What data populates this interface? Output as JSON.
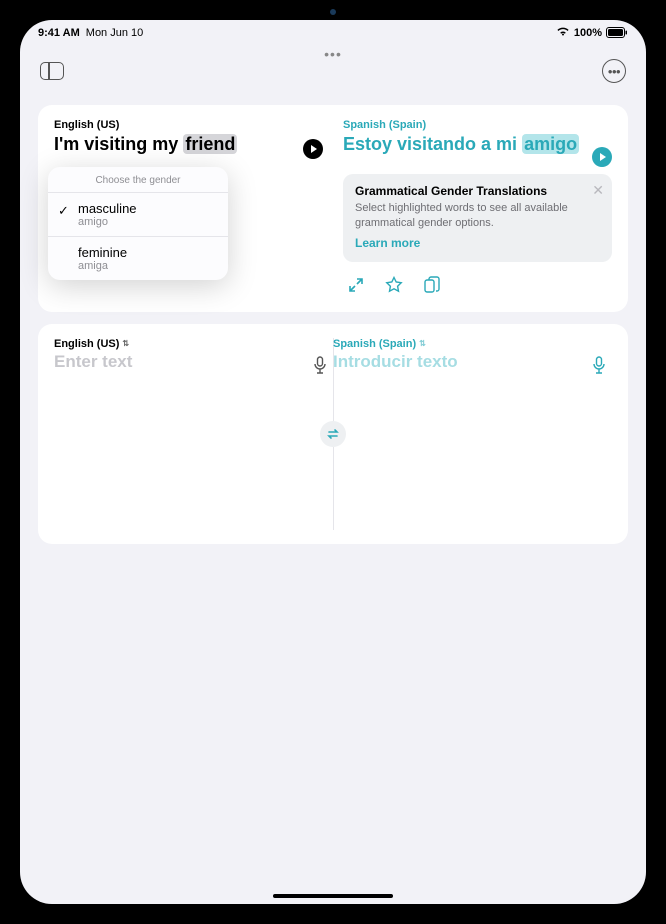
{
  "status": {
    "time": "9:41 AM",
    "date": "Mon Jun 10",
    "battery": "100%"
  },
  "source": {
    "lang": "English (US)",
    "prefix": "I'm visiting my ",
    "highlighted": "friend"
  },
  "target": {
    "lang": "Spanish (Spain)",
    "prefix": "Estoy visitando a mi ",
    "highlighted": "amigo"
  },
  "popover": {
    "header": "Choose the gender",
    "options": [
      {
        "title": "masculine",
        "subtitle": "amigo",
        "selected": true
      },
      {
        "title": "feminine",
        "subtitle": "amiga",
        "selected": false
      }
    ]
  },
  "info": {
    "title": "Grammatical Gender Translations",
    "desc": "Select highlighted words to see all available grammatical gender options.",
    "link": "Learn more"
  },
  "input": {
    "source_lang": "English (US)",
    "source_placeholder": "Enter text",
    "target_lang": "Spanish (Spain)",
    "target_placeholder": "Introducir texto"
  }
}
